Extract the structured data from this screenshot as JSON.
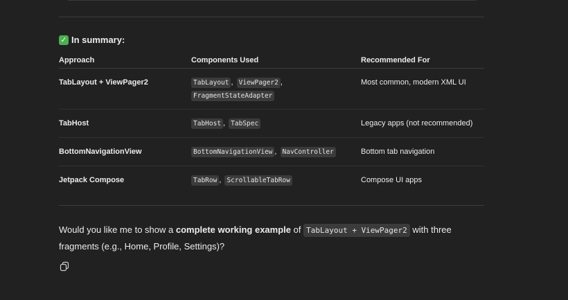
{
  "summary": {
    "heading_icon": "check-mark-emoji",
    "heading": "In summary:",
    "columns": [
      "Approach",
      "Components Used",
      "Recommended For"
    ],
    "rows": [
      {
        "approach": "TabLayout + ViewPager2",
        "components": [
          "TabLayout",
          "ViewPager2",
          "FragmentStateAdapter"
        ],
        "recommended": "Most common, modern XML UI"
      },
      {
        "approach": "TabHost",
        "components": [
          "TabHost",
          "TabSpec"
        ],
        "recommended": "Legacy apps (not recommended)"
      },
      {
        "approach": "BottomNavigationView",
        "components": [
          "BottomNavigationView",
          "NavController"
        ],
        "recommended": "Bottom tab navigation"
      },
      {
        "approach": "Jetpack Compose",
        "components": [
          "TabRow",
          "ScrollableTabRow"
        ],
        "recommended": "Compose UI apps"
      }
    ]
  },
  "question": {
    "before": "Would you like me to show a ",
    "bold": "complete working example",
    "middle": " of ",
    "code": "TabLayout + ViewPager2",
    "after": " with three fragments (e.g., Home, Profile, Settings)?"
  },
  "actions": {
    "copy_icon": "copy-icon"
  },
  "colors": {
    "background": "#212121",
    "text": "#ececec",
    "code_bg": "#3b3b3b",
    "check": "#4caf50"
  }
}
